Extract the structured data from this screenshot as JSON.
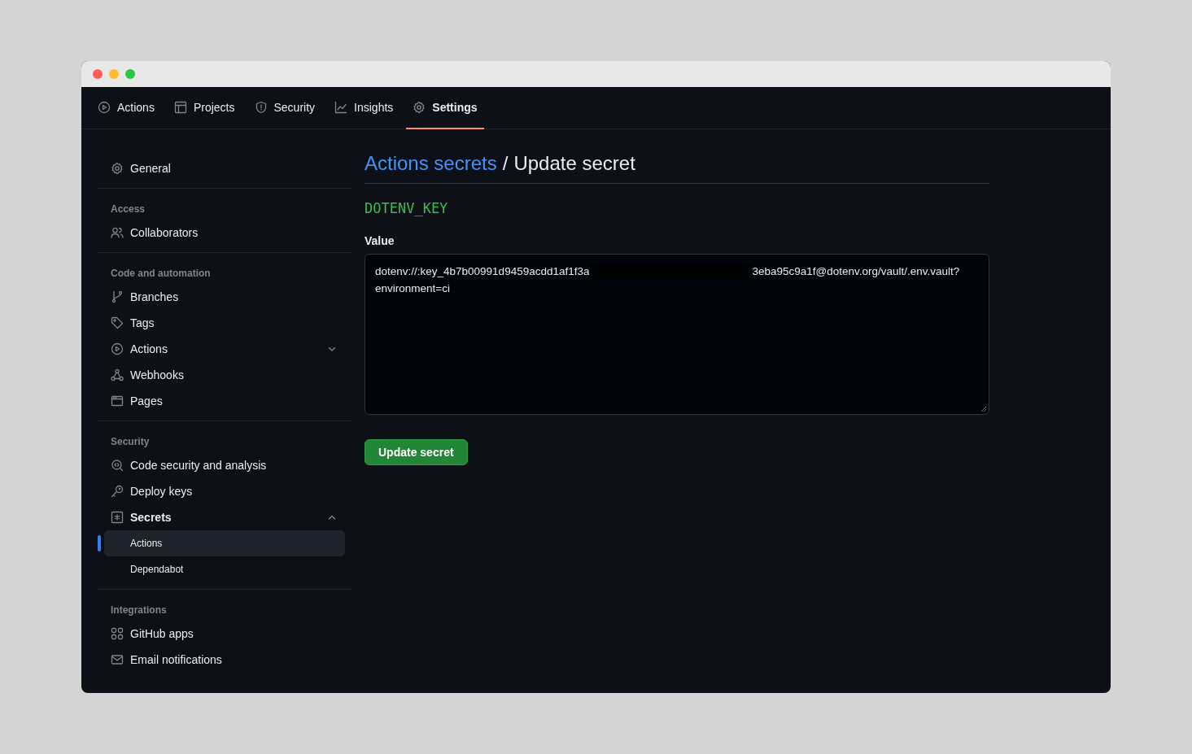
{
  "tabs": [
    {
      "label": "Actions",
      "selected": false
    },
    {
      "label": "Projects",
      "selected": false
    },
    {
      "label": "Security",
      "selected": false
    },
    {
      "label": "Insights",
      "selected": false
    },
    {
      "label": "Settings",
      "selected": true
    }
  ],
  "sidebar": {
    "groups": [
      {
        "items": [
          {
            "label": "General",
            "selected": false
          }
        ]
      },
      {
        "heading": "Access",
        "items": [
          {
            "label": "Collaborators",
            "selected": false
          }
        ]
      },
      {
        "heading": "Code and automation",
        "items": [
          {
            "label": "Branches",
            "selected": false
          },
          {
            "label": "Tags",
            "selected": false
          },
          {
            "label": "Actions",
            "selected": false,
            "expanded": false
          },
          {
            "label": "Webhooks",
            "selected": false
          },
          {
            "label": "Pages",
            "selected": false
          }
        ]
      },
      {
        "heading": "Security",
        "items": [
          {
            "label": "Code security and analysis",
            "selected": false
          },
          {
            "label": "Deploy keys",
            "selected": false
          },
          {
            "label": "Secrets",
            "selected": false,
            "expanded": true,
            "children": [
              {
                "label": "Actions",
                "selected": true
              },
              {
                "label": "Dependabot",
                "selected": false
              }
            ]
          }
        ]
      },
      {
        "heading": "Integrations",
        "items": [
          {
            "label": "GitHub apps",
            "selected": false
          },
          {
            "label": "Email notifications",
            "selected": false
          }
        ]
      }
    ]
  },
  "header": {
    "breadcrumb_link": "Actions secrets",
    "separator": "/",
    "title": "Update secret"
  },
  "secret_name": "DOTENV_KEY",
  "value_label": "Value",
  "value_segments": [
    {
      "kind": "text",
      "text": "dotenv://:key_4b7b00991d9459acdd1af1f3a"
    },
    {
      "kind": "redacted"
    },
    {
      "kind": "text",
      "text": "3eba95c9a1f@dotenv.org/vault/.env.vault?"
    },
    {
      "kind": "break"
    },
    {
      "kind": "text",
      "text": "environment=ci"
    }
  ],
  "submit_button": "Update secret"
}
